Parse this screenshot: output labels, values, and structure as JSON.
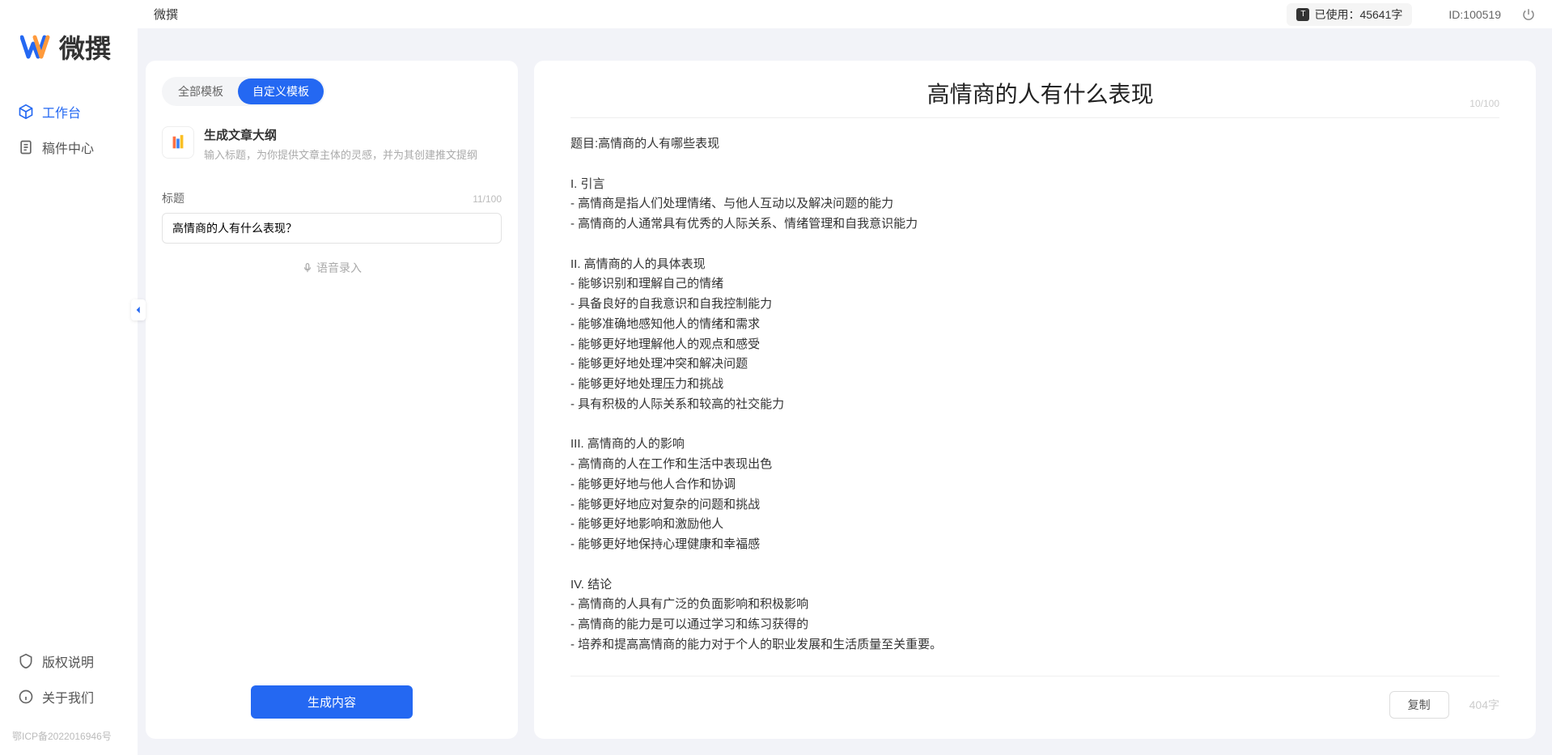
{
  "app": {
    "name_text": "微撰",
    "title": "微撰"
  },
  "sidebar": {
    "nav": [
      {
        "label": "工作台",
        "icon": "cube-icon",
        "active": true
      },
      {
        "label": "稿件中心",
        "icon": "doc-icon",
        "active": false
      }
    ],
    "bottom": [
      {
        "label": "版权说明",
        "icon": "shield-icon"
      },
      {
        "label": "关于我们",
        "icon": "info-icon"
      }
    ],
    "footer": "鄂ICP备2022016946号"
  },
  "topbar": {
    "usage_label": "已使用：45641字",
    "user_id": "ID:100519"
  },
  "left": {
    "tabs": {
      "all": "全部模板",
      "custom": "自定义模板"
    },
    "template": {
      "title": "生成文章大纲",
      "desc": "输入标题，为你提供文章主体的灵感，并为其创建推文提纲"
    },
    "field": {
      "label": "标题",
      "counter": "11/100",
      "value": "高情商的人有什么表现？"
    },
    "voice": "语音录入",
    "generate": "生成内容"
  },
  "right": {
    "title": "高情商的人有什么表现",
    "title_counter": "10/100",
    "body": "题目:高情商的人有哪些表现\n\nI. 引言\n- 高情商是指人们处理情绪、与他人互动以及解决问题的能力\n- 高情商的人通常具有优秀的人际关系、情绪管理和自我意识能力\n\nII. 高情商的人的具体表现\n- 能够识别和理解自己的情绪\n- 具备良好的自我意识和自我控制能力\n- 能够准确地感知他人的情绪和需求\n- 能够更好地理解他人的观点和感受\n- 能够更好地处理冲突和解决问题\n- 能够更好地处理压力和挑战\n- 具有积极的人际关系和较高的社交能力\n\nIII. 高情商的人的影响\n- 高情商的人在工作和生活中表现出色\n- 能够更好地与他人合作和协调\n- 能够更好地应对复杂的问题和挑战\n- 能够更好地影响和激励他人\n- 能够更好地保持心理健康和幸福感\n\nIV. 结论\n- 高情商的人具有广泛的负面影响和积极影响\n- 高情商的能力是可以通过学习和练习获得的\n- 培养和提高高情商的能力对于个人的职业发展和生活质量至关重要。",
    "copy": "复制",
    "char_count": "404字"
  }
}
